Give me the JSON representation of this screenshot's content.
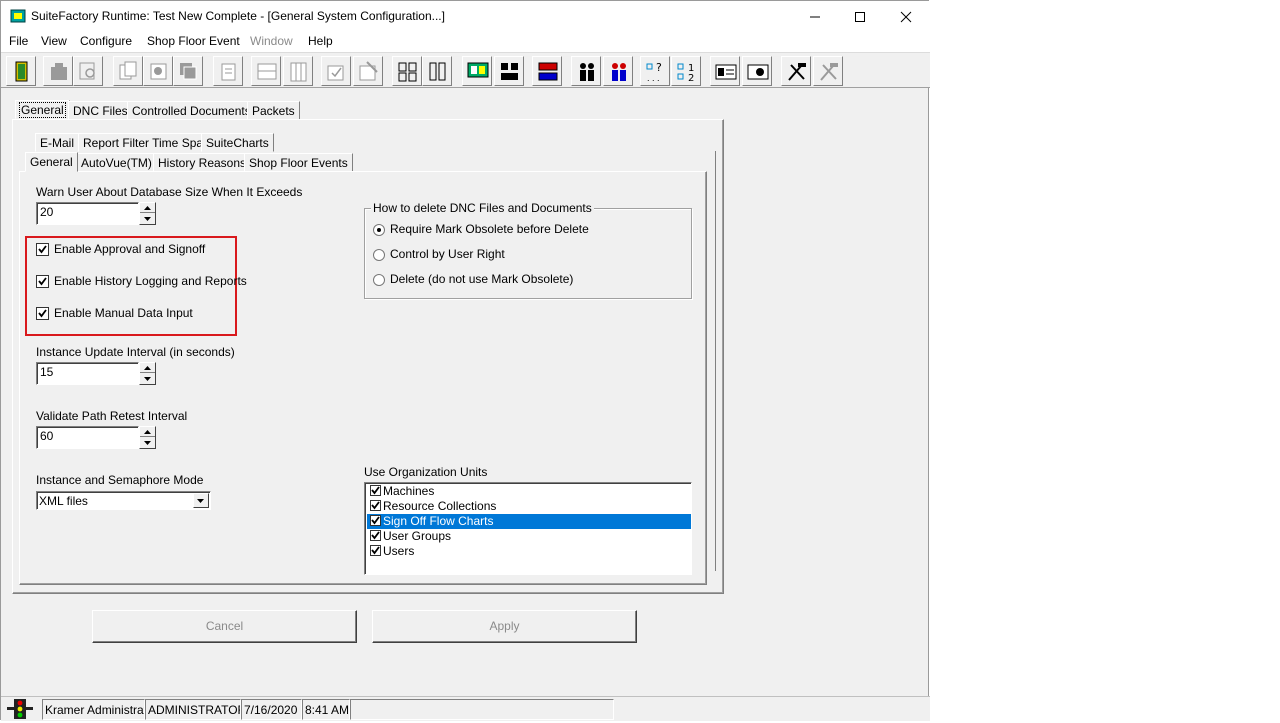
{
  "window": {
    "title": "SuiteFactory Runtime: Test New Complete - [General System Configuration...]",
    "controls": {
      "minimize": "—",
      "maximize": "☐",
      "close": "✕"
    }
  },
  "menu": {
    "file": "File",
    "view": "View",
    "configure": "Configure",
    "shop_floor_event": "Shop Floor Event",
    "window": "Window",
    "help": "Help"
  },
  "toolbar_icons": [
    "exit-door-icon",
    "machine-icon",
    "search-machine-icon",
    "documents-icon",
    "document-settings-icon",
    "packets-icon",
    "report-icon",
    "part-list-icon",
    "columns-icon",
    "approve-document-icon",
    "sign-document-icon",
    "flowchart-icon",
    "flowchart-multi-icon",
    "monitor-chart-icon",
    "hierarchy-icon",
    "network-icon",
    "users-icon",
    "user-groups-icon",
    "help-query-icon",
    "numbered-list-icon",
    "id-card-icon",
    "license-icon",
    "tools-icon",
    "tools-disabled-icon"
  ],
  "outer_tabs": [
    "General",
    "DNC Files",
    "Controlled Documents",
    "Packets"
  ],
  "inner_tabs_row1": [
    "E-Mail",
    "Report Filter Time Span",
    "SuiteCharts"
  ],
  "inner_tabs_row2": [
    "General",
    "AutoVue(TM)",
    "History Reasons",
    "Shop Floor Events"
  ],
  "general": {
    "db_size_label": "Warn User About Database Size When It Exceeds",
    "db_size_value": "20",
    "checkboxes": [
      {
        "label": "Enable Approval and Signoff",
        "checked": true
      },
      {
        "label": "Enable History Logging and Reports",
        "checked": true
      },
      {
        "label": "Enable Manual Data Input",
        "checked": true
      }
    ],
    "instance_interval_label": "Instance Update Interval (in seconds)",
    "instance_interval_value": "15",
    "validate_label": "Validate Path Retest Interval",
    "validate_value": "60",
    "semaphore_label": "Instance and Semaphore Mode",
    "semaphore_value": "XML files"
  },
  "delete_group": {
    "title": "How to delete DNC Files and Documents",
    "options": [
      {
        "label": "Require Mark Obsolete before Delete",
        "selected": true
      },
      {
        "label": "Control by User Right",
        "selected": false
      },
      {
        "label": "Delete (do not use Mark Obsolete)",
        "selected": false
      }
    ]
  },
  "org_units": {
    "label": "Use Organization Units",
    "items": [
      {
        "label": "Machines",
        "checked": true,
        "selected": false
      },
      {
        "label": "Resource Collections",
        "checked": true,
        "selected": false
      },
      {
        "label": "Sign Off Flow Charts",
        "checked": true,
        "selected": true
      },
      {
        "label": "User Groups",
        "checked": true,
        "selected": false
      },
      {
        "label": "Users",
        "checked": true,
        "selected": false
      }
    ]
  },
  "buttons": {
    "cancel": "Cancel",
    "apply": "Apply"
  },
  "status": {
    "user": "Kramer Administrator",
    "role": "ADMINISTRATOR",
    "date": "7/16/2020",
    "time": "8:41 AM"
  },
  "colors": {
    "selection": "#0078d7",
    "highlight_box": "#d9191c",
    "face": "#f0f0f0"
  }
}
